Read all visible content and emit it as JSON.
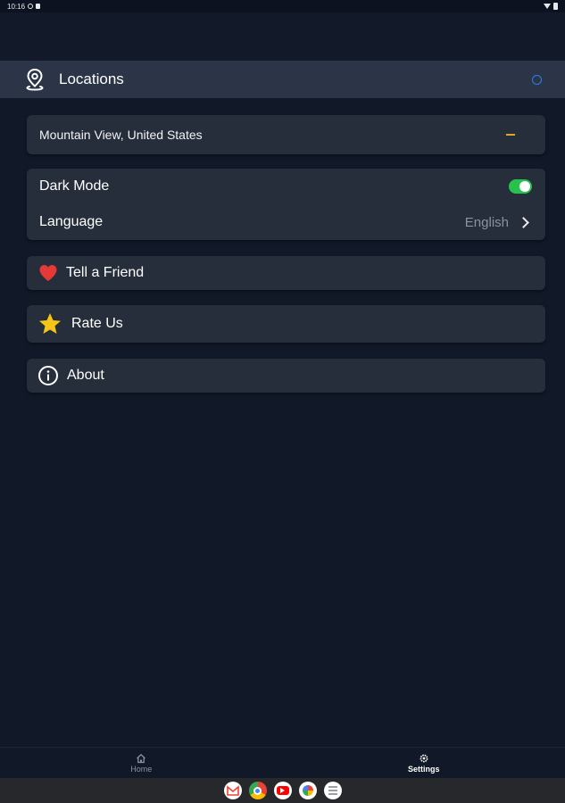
{
  "status_bar": {
    "time": "10:16"
  },
  "header": {
    "title": "Locations"
  },
  "location": {
    "name": "Mountain View, United States"
  },
  "settings": {
    "dark_mode_label": "Dark Mode",
    "dark_mode_on": true,
    "language_label": "Language",
    "language_value": "English"
  },
  "actions": {
    "tell_friend": "Tell a Friend",
    "rate_us": "Rate Us",
    "about": "About"
  },
  "bottom_nav": {
    "home": "Home",
    "settings": "Settings",
    "active": "settings"
  },
  "taskbar": {
    "apps": [
      "gmail-icon",
      "chrome-icon",
      "youtube-icon",
      "photos-icon",
      "app-drawer-icon"
    ]
  },
  "colors": {
    "background": "#111827",
    "card": "#272e3b",
    "header_bar": "#2b3547",
    "toggle_on": "#27c24c",
    "heart": "#e53935",
    "star": "#f5c518",
    "loading_ring": "#2f7fe6",
    "minus": "#e0a726"
  }
}
